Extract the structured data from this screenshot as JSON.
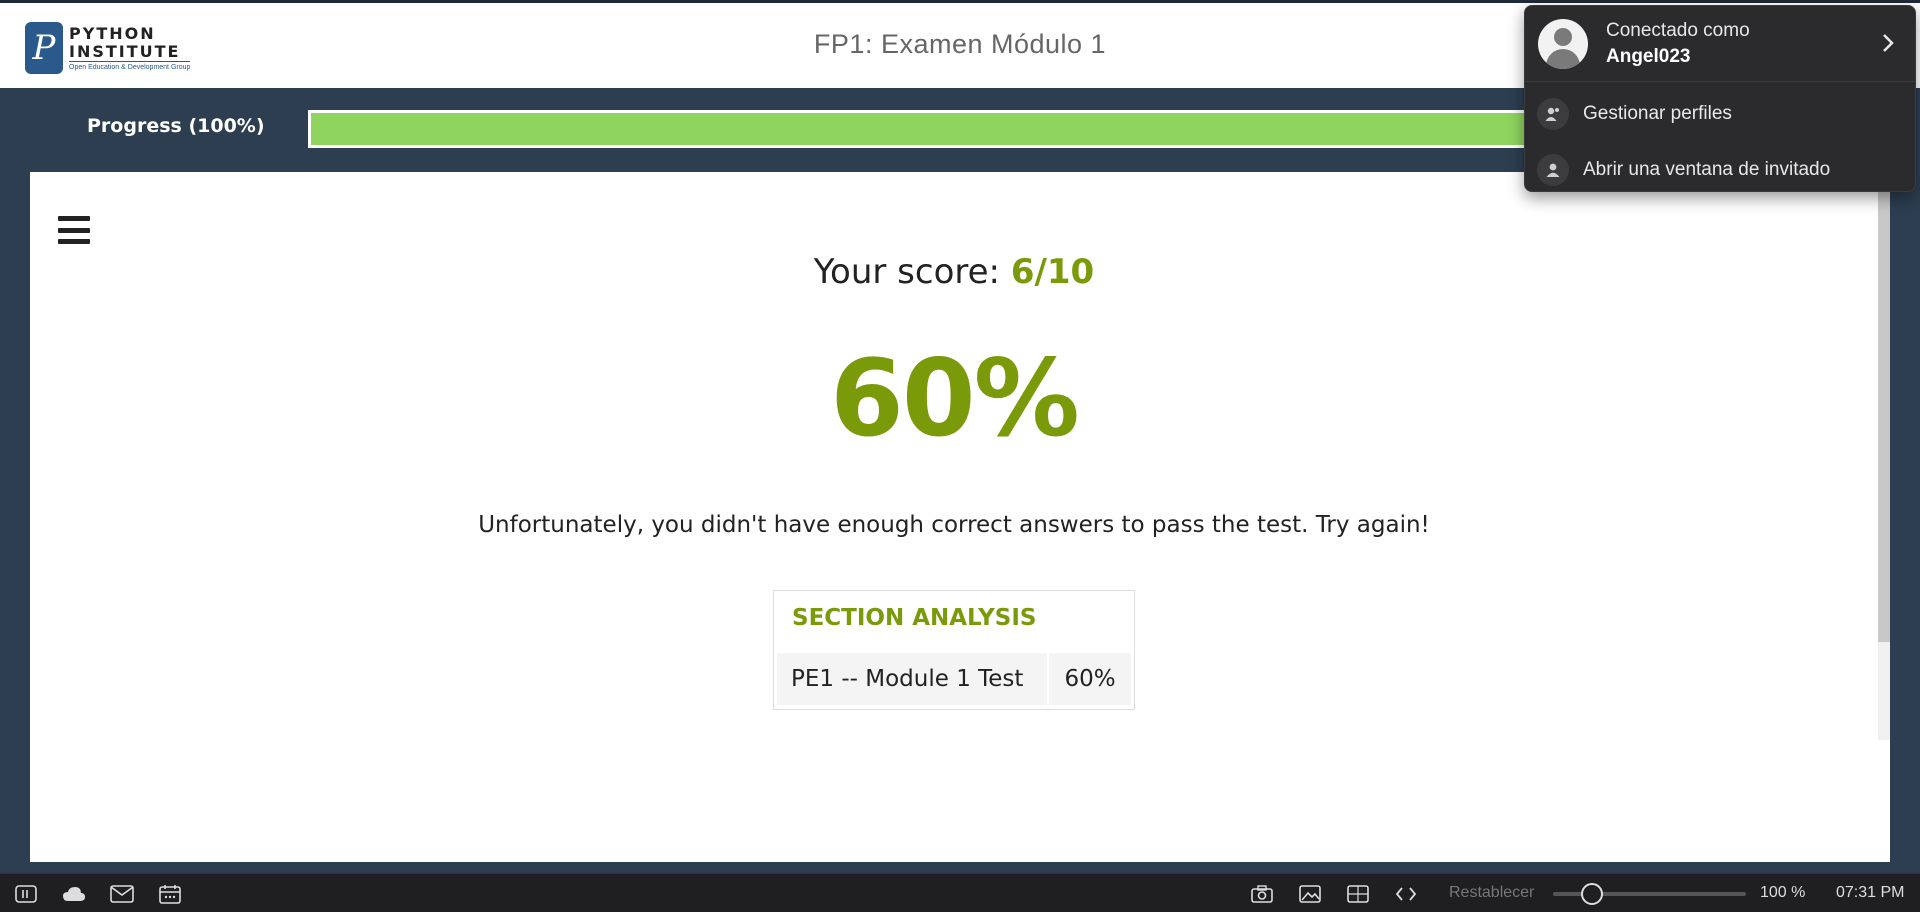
{
  "header": {
    "logo": {
      "line1": "PYTHON",
      "line2": "INSTITUTE",
      "line3": "Open Education & Development Group"
    },
    "title": "FP1: Examen Módulo 1"
  },
  "progress": {
    "label": "Progress (100%)",
    "value": 100,
    "color": "#8fd45f"
  },
  "result": {
    "score_prefix": "Your score: ",
    "score_value": "6/10",
    "percent": "60%",
    "message": "Unfortunately, you didn't have enough correct answers to pass the test. Try again!",
    "accent_color": "#7a9a0a"
  },
  "section_analysis": {
    "title": "SECTION ANALYSIS",
    "rows": [
      {
        "name": "PE1 -- Module 1 Test",
        "percent": "60%"
      }
    ]
  },
  "profile_menu": {
    "connected_label": "Conectado como",
    "username": "Angel023",
    "items": [
      {
        "label": "Gestionar perfiles",
        "icon": "manage-profiles-icon"
      },
      {
        "label": "Abrir una ventana de invitado",
        "icon": "guest-icon"
      }
    ]
  },
  "bottom_bar": {
    "left_icons": [
      "sidebar-icon",
      "cloud-icon",
      "mail-icon",
      "calendar-icon"
    ],
    "right_icons": [
      "camera-icon",
      "image-icon",
      "window-icon",
      "code-icon"
    ],
    "reset_label": "Restablecer",
    "zoom": "100 %",
    "zoom_level": 0.2,
    "time": "07:31 PM"
  }
}
